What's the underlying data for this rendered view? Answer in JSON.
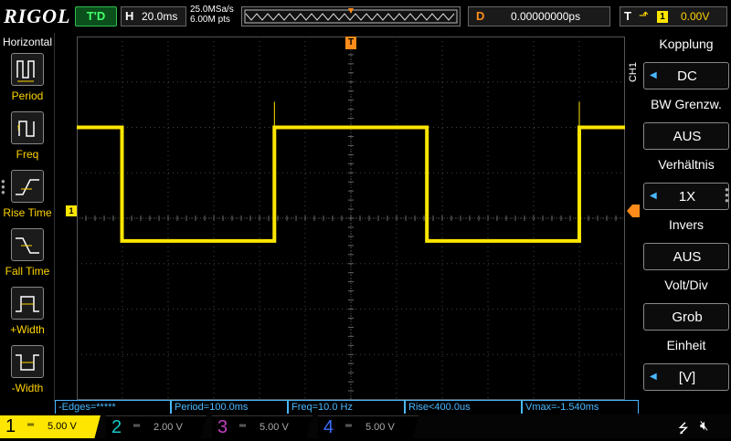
{
  "header": {
    "logo": "RIGOL",
    "run_status": "T'D",
    "horizontal": {
      "letter": "H",
      "timebase": "20.0ms"
    },
    "sample_rate": "25.0MSa/s",
    "memory_depth": "6.00M pts",
    "delay": {
      "letter": "D",
      "value": "0.00000000ps"
    },
    "trigger": {
      "letter": "T",
      "edge_icon": "rising-edge-icon",
      "source": "1",
      "level": "0.00V"
    }
  },
  "left_menu": {
    "title": "Horizontal",
    "items": [
      {
        "label": "Period",
        "icon": "period-icon"
      },
      {
        "label": "Freq",
        "icon": "freq-icon"
      },
      {
        "label": "Rise Time",
        "icon": "rise-time-icon"
      },
      {
        "label": "Fall Time",
        "icon": "fall-time-icon"
      },
      {
        "label": "+Width",
        "icon": "pos-width-icon"
      },
      {
        "label": "-Width",
        "icon": "neg-width-icon"
      }
    ]
  },
  "right_menu": {
    "channel": "CH1",
    "items": [
      {
        "title": "Kopplung",
        "value": "DC",
        "has_arrow": true
      },
      {
        "title": "BW Grenzw.",
        "value": "AUS",
        "has_arrow": false
      },
      {
        "title": "Verhältnis",
        "value": "1X",
        "has_arrow": true
      },
      {
        "title": "Invers",
        "value": "AUS",
        "has_arrow": false
      },
      {
        "title": "Volt/Div",
        "value": "Grob",
        "has_arrow": false
      },
      {
        "title": "Einheit",
        "value": "[V]",
        "has_arrow": true
      }
    ]
  },
  "markers": {
    "channel1": "1",
    "trigger_pos": "T"
  },
  "waveform": {
    "channel": "1",
    "color": "#ffe600",
    "high_level_div": 2.0,
    "low_level_div": -0.5,
    "edges_ms": [
      5,
      55,
      105,
      155
    ],
    "start_state": "high"
  },
  "measurements": [
    {
      "text": "-Edges=*****"
    },
    {
      "text": "Period=100.0ms"
    },
    {
      "text": "Freq=10.0 Hz"
    },
    {
      "text": "Rise<400.0us"
    },
    {
      "text": "Vmax=-1.540ms"
    }
  ],
  "channels": [
    {
      "num": "1",
      "coupling": "═",
      "scale": "5.00 V",
      "color": "#ffe600",
      "active": true
    },
    {
      "num": "2",
      "coupling": "═",
      "scale": "2.00 V",
      "color": "#19c6c6",
      "active": false
    },
    {
      "num": "3",
      "coupling": "═",
      "scale": "5.00 V",
      "color": "#c040c0",
      "active": false
    },
    {
      "num": "4",
      "coupling": "═",
      "scale": "5.00 V",
      "color": "#3b6cff",
      "active": false
    }
  ],
  "status_icons": [
    "usb-icon",
    "mute-icon"
  ],
  "colors": {
    "ch1": "#ffe600",
    "accent_orange": "#ff8c1a",
    "meas_blue": "#4ab8ff"
  }
}
